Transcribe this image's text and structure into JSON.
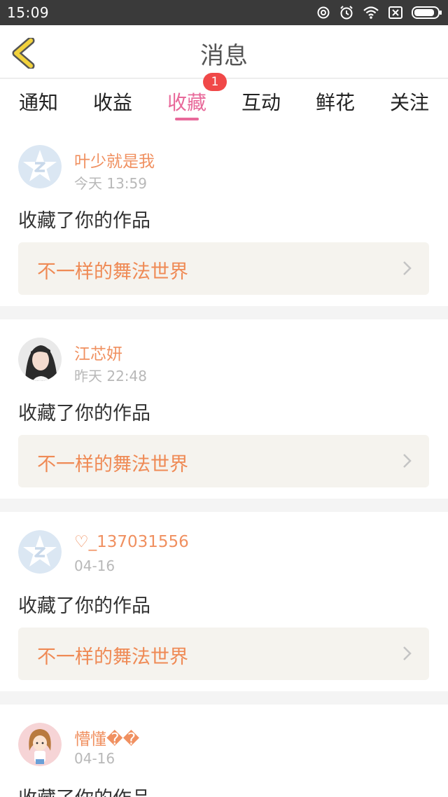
{
  "status_bar": {
    "time": "15:09",
    "icons": [
      "sync-icon",
      "alarm-icon",
      "wifi-icon",
      "sim-off-icon",
      "battery-icon"
    ]
  },
  "header": {
    "title": "消息",
    "back_icon": "chevron-left-icon"
  },
  "tabs": [
    {
      "label": "通知",
      "active": false
    },
    {
      "label": "收益",
      "active": false
    },
    {
      "label": "收藏",
      "active": true,
      "badge": "1"
    },
    {
      "label": "互动",
      "active": false
    },
    {
      "label": "鲜花",
      "active": false
    },
    {
      "label": "关注",
      "active": false
    }
  ],
  "messages": [
    {
      "user": "叶少就是我",
      "time": "今天 13:59",
      "action": "收藏了你的作品",
      "work": "不一样的舞法世界",
      "avatar": "qzone-default-avatar"
    },
    {
      "user": "江芯妍",
      "time": "昨天 22:48",
      "action": "收藏了你的作品",
      "work": "不一样的舞法世界",
      "avatar": "girl-photo-avatar"
    },
    {
      "user": "♡_137031556",
      "time": "04-16",
      "action": "收藏了你的作品",
      "work": "不一样的舞法世界",
      "avatar": "qzone-default-avatar"
    },
    {
      "user": "懵懂��",
      "time": "04-16",
      "action": "收藏了你的作品",
      "work": "",
      "avatar": "cartoon-girl-avatar"
    }
  ],
  "colors": {
    "accent_pink": "#e8699a",
    "username_orange": "#f09060",
    "work_title_orange": "#ef8a55",
    "badge_red": "#f04848",
    "back_arrow_yellow": "#f2d23c"
  }
}
